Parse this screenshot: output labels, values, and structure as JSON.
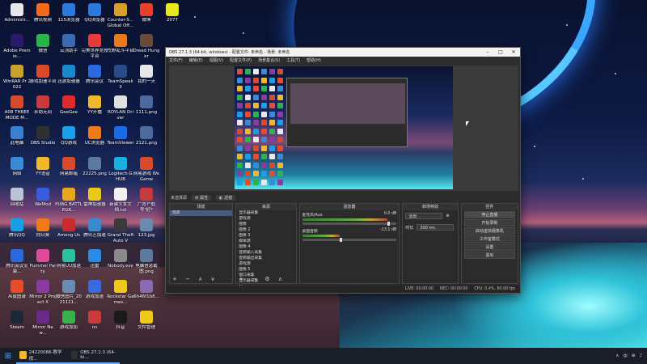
{
  "desktop": {
    "icons": [
      {
        "label": "Administr...",
        "color": "#e8e8e8"
      },
      {
        "label": "Adobe Premie...",
        "color": "#2a1a6a"
      },
      {
        "label": "WinRAR Pr 2022",
        "color": "#c9a12a"
      },
      {
        "label": "A08 THREE MODE M...",
        "color": "#d94a2a"
      },
      {
        "label": "此电脑",
        "color": "#3a7fd0"
      },
      {
        "label": "网络",
        "color": "#3a8ad8"
      },
      {
        "label": "回收站",
        "color": "#b8c4d4"
      },
      {
        "label": "腾讯QQ",
        "color": "#1a9ee8"
      },
      {
        "label": "腾讯会议安装...",
        "color": "#2a6ae0"
      },
      {
        "label": "Ai鼠图谱",
        "color": "#e84a2a"
      },
      {
        "label": "Steam",
        "color": "#1b2838"
      },
      {
        "label": "腾讯视频",
        "color": "#f26a1a"
      },
      {
        "label": "微信",
        "color": "#2ab54a"
      },
      {
        "label": "游戏加速平台",
        "color": "#d94a2a"
      },
      {
        "label": "永劫无间",
        "color": "#c93a3a"
      },
      {
        "label": "OBS Studio",
        "color": "#303030"
      },
      {
        "label": "YY语音",
        "color": "#f0b82a"
      },
      {
        "label": "WeMod",
        "color": "#3a5ae0"
      },
      {
        "label": "向日葵",
        "color": "#f07a1a"
      },
      {
        "label": "Pummel Party",
        "color": "#e04a9a"
      },
      {
        "label": "Mirror 2 Project X",
        "color": "#8a3aa0"
      },
      {
        "label": "Mirror New...",
        "color": "#6a2a8a"
      },
      {
        "label": "115浏览器",
        "color": "#2a7ae0"
      },
      {
        "label": "云顶助手",
        "color": "#3a6ab0"
      },
      {
        "label": "迅游加速器",
        "color": "#1a8ad0"
      },
      {
        "label": "GeeGee",
        "color": "#e02a2a"
      },
      {
        "label": "QQ游戏",
        "color": "#1aa0e8"
      },
      {
        "label": "网易邮箱",
        "color": "#d94a2a"
      },
      {
        "label": "PUBG BATTLEGR...",
        "color": "#e8a81a"
      },
      {
        "label": "Among Us",
        "color": "#c92a2a"
      },
      {
        "label": "网易UU加速",
        "color": "#2ac0a0"
      },
      {
        "label": "微信图片_2021121...",
        "color": "#6a8ab0"
      },
      {
        "label": "游戏加加",
        "color": "#3ab04a"
      },
      {
        "label": "QQ浏览器",
        "color": "#2a7ae0"
      },
      {
        "label": "完美世界竞技平台",
        "color": "#e83a3a"
      },
      {
        "label": "腾讯会议",
        "color": "#2a6ae0"
      },
      {
        "label": "YY开播",
        "color": "#f0b82a"
      },
      {
        "label": "UC浏览器",
        "color": "#f07a1a"
      },
      {
        "label": "22225.png",
        "color": "#5a7aa0"
      },
      {
        "label": "雷神加速器",
        "color": "#e8c81a"
      },
      {
        "label": "腾讯艺加速",
        "color": "#3a8ad0"
      },
      {
        "label": "迅雷",
        "color": "#2a8ae8"
      },
      {
        "label": "游戏加速",
        "color": "#3a6ae0"
      },
      {
        "label": "nn",
        "color": "#c93a3a"
      },
      {
        "label": "Counter-S... Global Off...",
        "color": "#d8a02a"
      },
      {
        "label": "荒野乱斗平台",
        "color": "#e87a1a"
      },
      {
        "label": "TeamSpeak 3",
        "color": "#2a4a8a"
      },
      {
        "label": "ROYLAN Driver",
        "color": "#e0e0e0"
      },
      {
        "label": "TeamViewer",
        "color": "#1a6ae8"
      },
      {
        "label": "Logitech G HUB",
        "color": "#1ab0e0"
      },
      {
        "label": "新建文本文档.txt",
        "color": "#f0f0f0"
      },
      {
        "label": "Grand Theft Auto V",
        "color": "#3a3a3a"
      },
      {
        "label": "Nobody.exe",
        "color": "#8a8a8a"
      },
      {
        "label": "Rockstar Games...",
        "color": "#f0c81a"
      },
      {
        "label": "抖音",
        "color": "#1a1a1a"
      },
      {
        "label": "微博",
        "color": "#e8402a"
      },
      {
        "label": "Dread Hunger",
        "color": "#6a4a3a"
      },
      {
        "label": "我的一天",
        "color": "#e8e8e8"
      },
      {
        "label": "1111.png",
        "color": "#4a6aa0"
      },
      {
        "label": "2121.png",
        "color": "#4a6aa0"
      },
      {
        "label": "网易游戏 WeGame",
        "color": "#d94a2a"
      },
      {
        "label": "广告?\"假号\"好*",
        "color": "#c93a3a"
      },
      {
        "label": "123.jpg",
        "color": "#6a8ab0"
      },
      {
        "label": "电脑信息截图.png",
        "color": "#5a7aa0"
      },
      {
        "label": "6h46f1b8...",
        "color": "#8a6ab0"
      },
      {
        "label": "文件管理",
        "color": "#f0c81a"
      },
      {
        "label": "2077",
        "color": "#e8e81a"
      }
    ]
  },
  "obs": {
    "title": "OBS 27.1.3 (64-bit, windows) - 配置文件: 未命名 - 场景: 未命名",
    "menu": [
      "文件(F)",
      "编辑(E)",
      "视图(V)",
      "配置文件(P)",
      "场景集合(S)",
      "工具(T)",
      "帮助(H)"
    ],
    "scene_label": "场景",
    "scene_toolbar": {
      "selector": "未选择源",
      "props": "属性",
      "filters": "滤镜"
    },
    "docks": {
      "scenes": {
        "title": "场景",
        "items": [
          "场景"
        ]
      },
      "sources": {
        "title": "来源",
        "items": [
          "显示器采集",
          "游戏源",
          "图像",
          "图像 2",
          "图像 3",
          "媒体源",
          "图像 4",
          "音频输入采集",
          "音频输出采集",
          "游戏源",
          "图像 5",
          "窗口采集",
          "显示器采集"
        ]
      },
      "mixer": {
        "title": "混音器",
        "rows": [
          {
            "name": "麦克风/Aux",
            "db": "0.0 dB",
            "level": 0.9
          },
          {
            "name": "桌面音频",
            "db": "-13.1 dB",
            "level": 0.4
          }
        ]
      },
      "transitions": {
        "title": "转场特效",
        "type": "淡出",
        "duration_label": "时长",
        "duration": "300 ms"
      },
      "controls": {
        "title": "控件",
        "buttons": [
          "停止直播",
          "开始录制",
          "启动虚拟摄像机",
          "工作室模式",
          "设置",
          "退出"
        ]
      }
    },
    "status": {
      "live": "LIVE: 00:00:00",
      "rec": "REC: 00:00:00",
      "cpu": "CPU: 0.4%, 60.00 fps"
    }
  },
  "taskbar": {
    "items": [
      {
        "label": "24220086-教学视...",
        "color": "#f0b82a"
      },
      {
        "label": "OBS 27.1.3 (64-bi...",
        "color": "#303030"
      }
    ],
    "tray": [
      "∧",
      "中",
      "⊕",
      "♪"
    ]
  }
}
